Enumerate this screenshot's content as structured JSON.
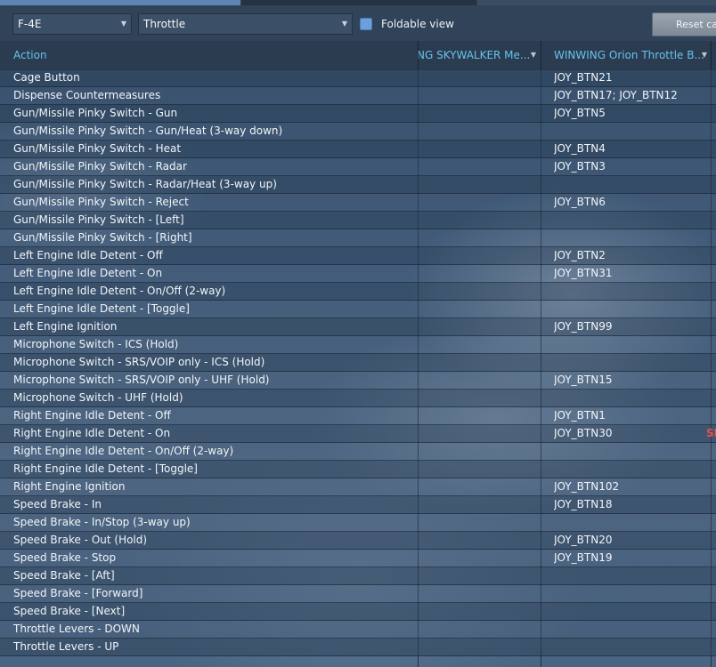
{
  "toolbar": {
    "aircraft_value": "F-4E",
    "category_value": "Throttle",
    "foldable_label": "Foldable view",
    "reset_label": "Reset ca"
  },
  "columns": {
    "action": "Action",
    "skywalker": "NG SKYWALKER Me...",
    "orion": "WINWING Orion Throttle B..."
  },
  "rows": [
    {
      "action": "Cage Button",
      "skywalker": "",
      "orion": "JOY_BTN21",
      "extra": ""
    },
    {
      "action": "Dispense Countermeasures",
      "skywalker": "",
      "orion": "JOY_BTN17; JOY_BTN12",
      "extra": ""
    },
    {
      "action": "Gun/Missile Pinky Switch - Gun",
      "skywalker": "",
      "orion": "JOY_BTN5",
      "extra": ""
    },
    {
      "action": "Gun/Missile Pinky Switch - Gun/Heat (3-way down)",
      "skywalker": "",
      "orion": "",
      "extra": ""
    },
    {
      "action": "Gun/Missile Pinky Switch - Heat",
      "skywalker": "",
      "orion": "JOY_BTN4",
      "extra": ""
    },
    {
      "action": "Gun/Missile Pinky Switch - Radar",
      "skywalker": "",
      "orion": "JOY_BTN3",
      "extra": ""
    },
    {
      "action": "Gun/Missile Pinky Switch - Radar/Heat (3-way up)",
      "skywalker": "",
      "orion": "",
      "extra": ""
    },
    {
      "action": "Gun/Missile Pinky Switch - Reject",
      "skywalker": "",
      "orion": "JOY_BTN6",
      "extra": ""
    },
    {
      "action": "Gun/Missile Pinky Switch - [Left]",
      "skywalker": "",
      "orion": "",
      "extra": ""
    },
    {
      "action": "Gun/Missile Pinky Switch - [Right]",
      "skywalker": "",
      "orion": "",
      "extra": ""
    },
    {
      "action": "Left Engine Idle Detent - Off",
      "skywalker": "",
      "orion": "JOY_BTN2",
      "extra": ""
    },
    {
      "action": "Left Engine Idle Detent - On",
      "skywalker": "",
      "orion": "JOY_BTN31",
      "extra": ""
    },
    {
      "action": "Left Engine Idle Detent - On/Off (2-way)",
      "skywalker": "",
      "orion": "",
      "extra": ""
    },
    {
      "action": "Left Engine Idle Detent - [Toggle]",
      "skywalker": "",
      "orion": "",
      "extra": ""
    },
    {
      "action": "Left Engine Ignition",
      "skywalker": "",
      "orion": "JOY_BTN99",
      "extra": ""
    },
    {
      "action": "Microphone Switch - ICS (Hold)",
      "skywalker": "",
      "orion": "",
      "extra": ""
    },
    {
      "action": "Microphone Switch - SRS/VOIP only - ICS (Hold)",
      "skywalker": "",
      "orion": "",
      "extra": ""
    },
    {
      "action": "Microphone Switch - SRS/VOIP only - UHF (Hold)",
      "skywalker": "",
      "orion": "JOY_BTN15",
      "extra": ""
    },
    {
      "action": "Microphone Switch - UHF (Hold)",
      "skywalker": "",
      "orion": "",
      "extra": ""
    },
    {
      "action": "Right Engine Idle Detent - Off",
      "skywalker": "",
      "orion": "JOY_BTN1",
      "extra": ""
    },
    {
      "action": "Right Engine Idle Detent - On",
      "skywalker": "",
      "orion": "JOY_BTN30",
      "extra": "SP"
    },
    {
      "action": "Right Engine Idle Detent - On/Off (2-way)",
      "skywalker": "",
      "orion": "",
      "extra": ""
    },
    {
      "action": "Right Engine Idle Detent - [Toggle]",
      "skywalker": "",
      "orion": "",
      "extra": ""
    },
    {
      "action": "Right Engine Ignition",
      "skywalker": "",
      "orion": "JOY_BTN102",
      "extra": ""
    },
    {
      "action": "Speed Brake - In",
      "skywalker": "",
      "orion": "JOY_BTN18",
      "extra": ""
    },
    {
      "action": "Speed Brake - In/Stop (3-way up)",
      "skywalker": "",
      "orion": "",
      "extra": ""
    },
    {
      "action": "Speed Brake - Out (Hold)",
      "skywalker": "",
      "orion": "JOY_BTN20",
      "extra": ""
    },
    {
      "action": "Speed Brake - Stop",
      "skywalker": "",
      "orion": "JOY_BTN19",
      "extra": ""
    },
    {
      "action": "Speed Brake - [Aft]",
      "skywalker": "",
      "orion": "",
      "extra": ""
    },
    {
      "action": "Speed Brake - [Forward]",
      "skywalker": "",
      "orion": "",
      "extra": ""
    },
    {
      "action": "Speed Brake - [Next]",
      "skywalker": "",
      "orion": "",
      "extra": ""
    },
    {
      "action": "Throttle Levers - DOWN",
      "skywalker": "",
      "orion": "",
      "extra": ""
    },
    {
      "action": "Throttle Levers - UP",
      "skywalker": "",
      "orion": "",
      "extra": ""
    }
  ],
  "colors": {
    "header_text": "#67c3ec",
    "checkbox_fill": "#6c9fdc",
    "warning_text": "#e8504c"
  },
  "icons": {
    "dropdown": "chevron-down-icon",
    "sort": "sort-arrow-icon"
  }
}
